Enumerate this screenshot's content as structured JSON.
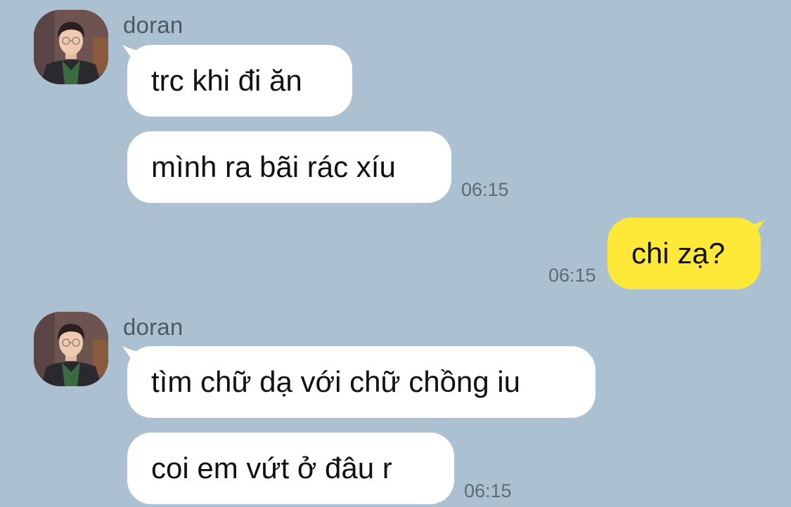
{
  "chat": {
    "messages": [
      {
        "direction": "incoming",
        "sender": "doran",
        "avatar_icon": "profile-photo",
        "lines": [
          {
            "text": "trc khi đi ăn",
            "time": ""
          },
          {
            "text": "mình ra bãi rác xíu",
            "time": "06:15"
          }
        ]
      },
      {
        "direction": "outgoing",
        "lines": [
          {
            "text": "chi zạ?",
            "time": "06:15"
          }
        ]
      },
      {
        "direction": "incoming",
        "sender": "doran",
        "avatar_icon": "profile-photo",
        "lines": [
          {
            "text": "tìm chữ dạ với chữ chồng iu",
            "time": ""
          },
          {
            "text": "coi em vứt ở đâu r",
            "time": "06:15"
          }
        ]
      }
    ]
  },
  "colors": {
    "background": "#abc1d1",
    "incoming_bubble": "#ffffff",
    "outgoing_bubble": "#fee939",
    "name_text": "#4d5966",
    "time_text": "#5e6a76"
  }
}
